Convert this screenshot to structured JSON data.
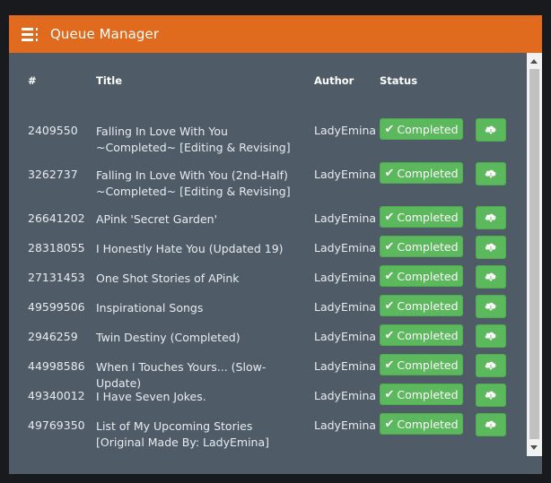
{
  "window": {
    "title": "Queue Manager",
    "icon": "server-icon"
  },
  "table": {
    "headers": {
      "num": "#",
      "title": "Title",
      "author": "Author",
      "status": "Status"
    },
    "rows": [
      {
        "id": "2409550",
        "title": "Falling In Love With You ~Completed~ [Editing & Revising]",
        "author": "LadyEmina",
        "status": "Completed"
      },
      {
        "id": "3262737",
        "title": "Falling In Love With You (2nd-Half) ~Completed~ [Editing & Revising]",
        "author": "LadyEmina",
        "status": "Completed"
      },
      {
        "id": "26641202",
        "title": "APink 'Secret Garden'",
        "author": "LadyEmina",
        "status": "Completed"
      },
      {
        "id": "28318055",
        "title": "I Honestly Hate You (Updated 19)",
        "author": "LadyEmina",
        "status": "Completed"
      },
      {
        "id": "27131453",
        "title": "One Shot Stories of APink",
        "author": "LadyEmina",
        "status": "Completed"
      },
      {
        "id": "49599506",
        "title": "Inspirational Songs",
        "author": "LadyEmina",
        "status": "Completed"
      },
      {
        "id": "2946259",
        "title": "Twin Destiny (Completed)",
        "author": "LadyEmina",
        "status": "Completed"
      },
      {
        "id": "44998586",
        "title": "When I Touches Yours... (Slow-Update)",
        "author": "LadyEmina",
        "status": "Completed"
      },
      {
        "id": "49340012",
        "title": "I Have Seven Jokes.",
        "author": "LadyEmina",
        "status": "Completed"
      },
      {
        "id": "49769350",
        "title": "List of My Upcoming Stories [Original Made By: LadyEmina]",
        "author": "LadyEmina",
        "status": "Completed"
      }
    ]
  },
  "colors": {
    "accent": "#e06a1d",
    "panel": "#4f5b67",
    "success": "#5cb85c"
  }
}
